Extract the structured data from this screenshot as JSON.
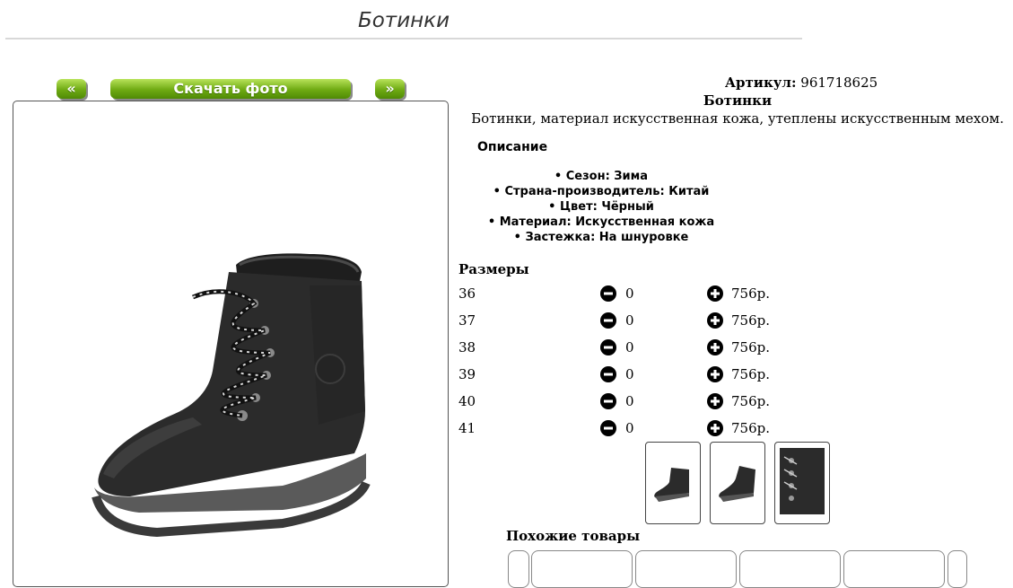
{
  "page": {
    "title": "Ботинки"
  },
  "gallery": {
    "prev_label": "«",
    "download_label": "Скачать фото",
    "next_label": "»"
  },
  "product": {
    "article_label": "Артикул:",
    "article_value": "961718625",
    "name": "Ботинки",
    "short_description": "Ботинки, материал искусственная кожа, утеплены искусственным мехом.",
    "description_heading": "Описание",
    "features": [
      "• Сезон: Зима",
      "• Страна-производитель: Китай",
      "• Цвет: Чёрный",
      "• Материал: Искусственная кожа",
      "• Застежка: На шнуровке"
    ]
  },
  "sizes": {
    "heading": "Размеры",
    "rows": [
      {
        "size": "36",
        "qty": "0",
        "price": "756р."
      },
      {
        "size": "37",
        "qty": "0",
        "price": "756р."
      },
      {
        "size": "38",
        "qty": "0",
        "price": "756р."
      },
      {
        "size": "39",
        "qty": "0",
        "price": "756р."
      },
      {
        "size": "40",
        "qty": "0",
        "price": "756р."
      },
      {
        "size": "41",
        "qty": "0",
        "price": "756р."
      }
    ]
  },
  "similar": {
    "heading": "Похожие товары"
  },
  "icons": {
    "minus": "minus-circle-icon",
    "plus": "plus-circle-icon"
  },
  "colors": {
    "button_green": "#6eaa12",
    "boot": "#2a2a2a",
    "sole": "#555555"
  }
}
